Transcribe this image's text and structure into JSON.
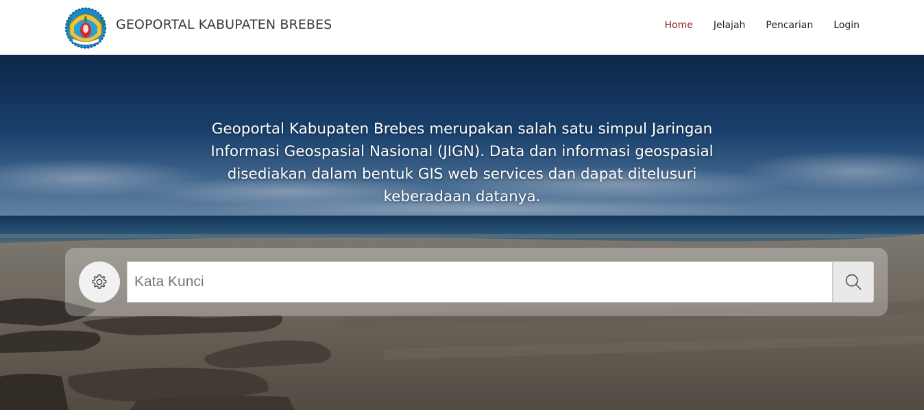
{
  "header": {
    "title": "GEOPORTAL KABUPATEN BREBES",
    "logo_icon": "kabupaten-brebes-emblem"
  },
  "nav": {
    "items": [
      {
        "label": "Home",
        "active": true
      },
      {
        "label": "Jelajah",
        "active": false
      },
      {
        "label": "Pencarian",
        "active": false
      },
      {
        "label": "Login",
        "active": false
      }
    ],
    "active_color": "#8b1a1a"
  },
  "hero": {
    "description": "Geoportal Kabupaten Brebes merupakan salah satu simpul Jaringan Informasi Geospasial Nasional (JIGN). Data dan informasi geospasial disediakan dalam bentuk GIS web services dan dapat ditelusuri keberadaan datanya.",
    "background": "beach-photo"
  },
  "search": {
    "placeholder": "Kata Kunci",
    "value": "",
    "settings_icon": "gear-icon",
    "submit_icon": "search-icon"
  }
}
